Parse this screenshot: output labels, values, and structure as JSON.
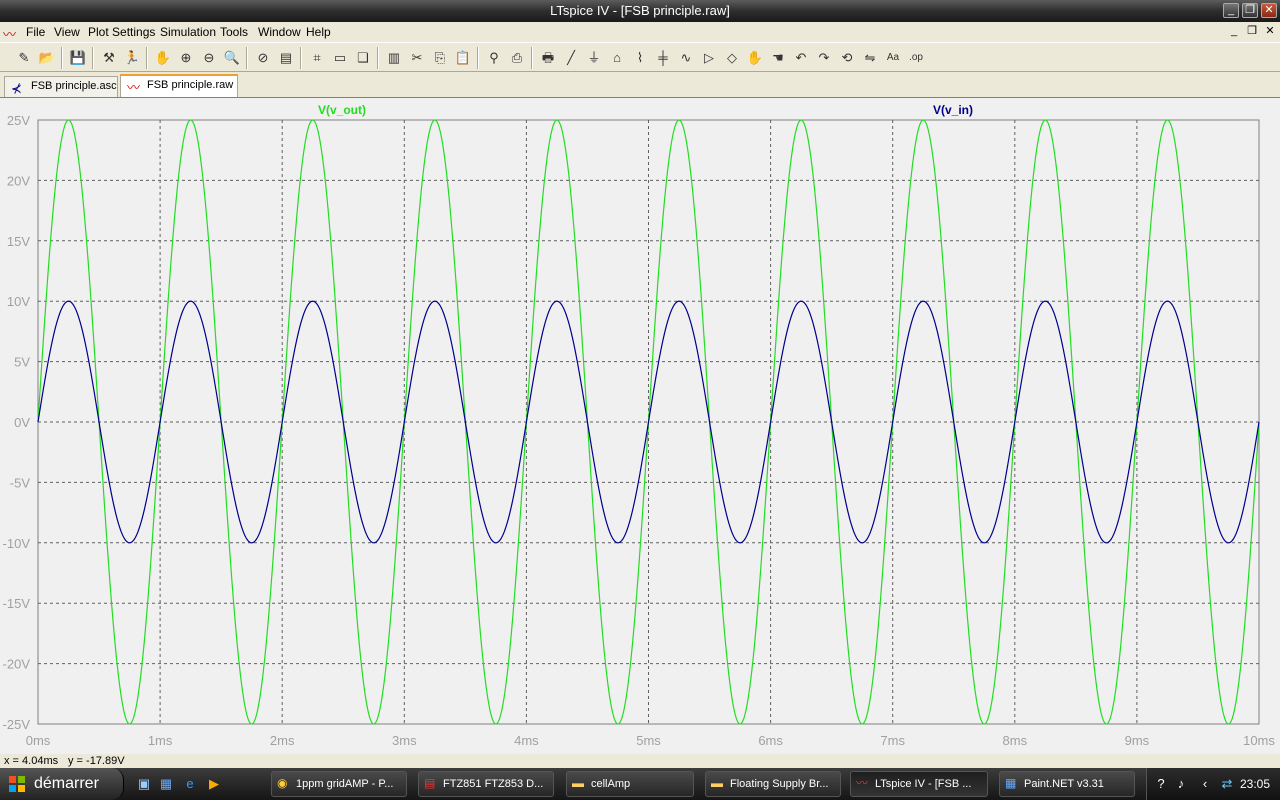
{
  "window": {
    "title": "LTspice IV - [FSB principle.raw]"
  },
  "menu": [
    "File",
    "View",
    "Plot Settings",
    "Simulation",
    "Tools",
    "Window",
    "Help"
  ],
  "tabs": [
    {
      "label": "FSB principle.asc",
      "icon": "schematic-icon"
    },
    {
      "label": "FSB principle.raw",
      "icon": "waveform-icon",
      "active": true
    }
  ],
  "toolbar_icons": [
    "new-schematic-icon",
    "open-icon",
    "save-icon",
    "control-panel-icon",
    "run-icon",
    "pan-hand-icon",
    "zoom-in-icon",
    "zoom-out-icon",
    "zoom-area-icon",
    "zoom-cancel-icon",
    "autorange-icon",
    "pick-traces-icon",
    "tile-horizontal-icon",
    "cascade-icon",
    "tile-vertical-icon",
    "cut-icon",
    "copy-icon",
    "paste-icon",
    "find-icon",
    "print-preview-icon",
    "print-icon",
    "wire-icon",
    "ground-icon",
    "label-net-icon",
    "resistor-icon",
    "capacitor-icon",
    "inductor-icon",
    "diode-icon",
    "component-icon",
    "move-icon",
    "drag-icon",
    "undo-icon",
    "redo-icon",
    "rotate-icon",
    "mirror-icon",
    "text-icon",
    "spice-directive-icon"
  ],
  "status": {
    "x": "x = 4.04ms",
    "y": "y = -17.89V"
  },
  "chart_data": {
    "type": "line",
    "title": "",
    "x_unit": "ms",
    "xlim": [
      0,
      10
    ],
    "ylim": [
      -25,
      25
    ],
    "x_ticks": [
      "0ms",
      "1ms",
      "2ms",
      "3ms",
      "4ms",
      "5ms",
      "6ms",
      "7ms",
      "8ms",
      "9ms",
      "10ms"
    ],
    "y_ticks": [
      "25V",
      "20V",
      "15V",
      "10V",
      "5V",
      "0V",
      "-5V",
      "-10V",
      "-15V",
      "-20V",
      "-25V"
    ],
    "grid": true,
    "series": [
      {
        "name": "V(v_out)",
        "color": "#22dd22",
        "amplitude": 25,
        "frequency_hz": 1000,
        "phase_deg": 0
      },
      {
        "name": "V(v_in)",
        "color": "#00008b",
        "amplitude": 10,
        "frequency_hz": 1000,
        "phase_deg": 0
      }
    ]
  },
  "taskbar": {
    "start_label": "démarrer",
    "quicklaunch": [
      "desktop-icon",
      "windows-icon",
      "ie-icon",
      "media-player-icon"
    ],
    "tasks": [
      {
        "label": "1ppm gridAMP - P...",
        "icon": "chrome-icon"
      },
      {
        "label": "FTZ851 FTZ853 D...",
        "icon": "pdf-icon"
      },
      {
        "label": "cellAmp",
        "icon": "folder-icon"
      },
      {
        "label": "Floating Supply Br...",
        "icon": "folder-icon"
      },
      {
        "label": "LTspice IV - [FSB ...",
        "icon": "ltspice-icon",
        "active": true
      },
      {
        "label": "Paint.NET v3.31",
        "icon": "paintnet-icon"
      }
    ],
    "clock": "23:05"
  }
}
